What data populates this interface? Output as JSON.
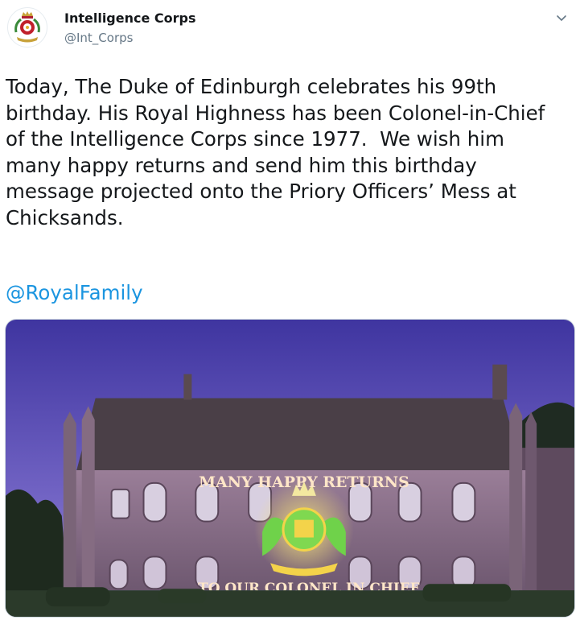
{
  "author": {
    "display_name": "Intelligence Corps",
    "handle": "@Int_Corps",
    "avatar_icon": "regimental-badge-icon"
  },
  "menu_icon": "chevron-down-icon",
  "tweet": {
    "text": "Today, The Duke of Edinburgh celebrates his 99th\nbirthday. His Royal Highness has been Colonel-in-Chief\nof the Intelligence Corps since 1977.  We wish him\nmany happy returns and send him this birthday\nmessage projected onto the Priory Officers’ Mess at\nChicksands.",
    "mention": "@RoyalFamily"
  },
  "media": {
    "projection_top": "MANY HAPPY RETURNS",
    "projection_bottom": "TO OUR COLONEL IN CHIEF",
    "colors": {
      "sky_top": "#4b3fa6",
      "sky_bottom": "#8a7ad0",
      "roof": "#4a3f47",
      "wall": "#8c6f86",
      "projection": "#ffe6c8",
      "emblem_green": "#6fd24a",
      "emblem_gold": "#f3d34a"
    }
  },
  "colors": {
    "text": "#14171a",
    "secondary": "#657786",
    "link": "#1b95e0"
  }
}
